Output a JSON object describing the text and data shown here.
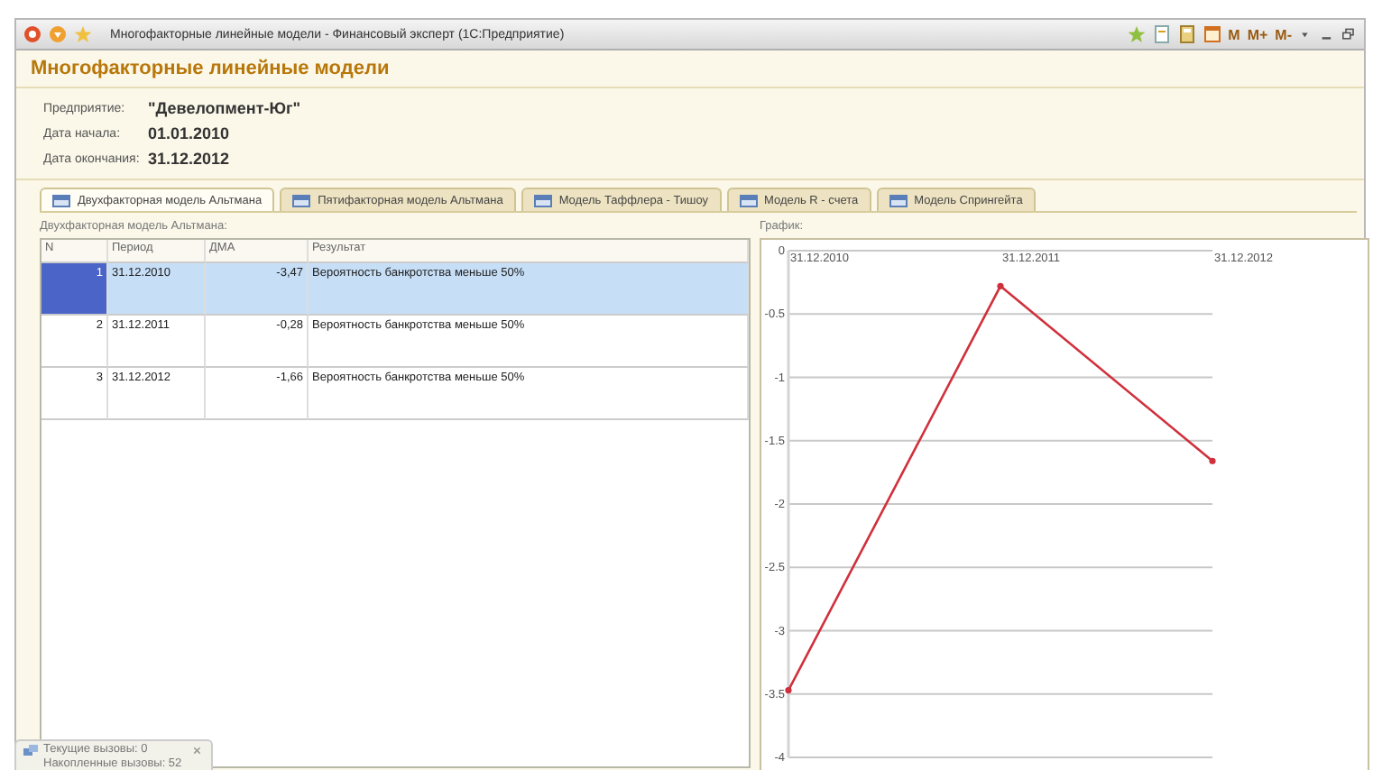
{
  "window": {
    "title": "Многофакторные линейные модели - Финансовый эксперт  (1С:Предприятие)",
    "toolbar_buttons": [
      "M",
      "M+",
      "M-"
    ]
  },
  "form": {
    "title": "Многофакторные линейные модели",
    "fields": [
      {
        "label": "Предприятие:",
        "value": "\"Девелопмент-Юг\""
      },
      {
        "label": "Дата начала:",
        "value": "01.01.2010"
      },
      {
        "label": "Дата окончания:",
        "value": "31.12.2012"
      }
    ]
  },
  "tabs": [
    {
      "label": "Двухфакторная модель Альтмана",
      "selected": true
    },
    {
      "label": "Пятифакторная модель Альтмана",
      "selected": false
    },
    {
      "label": "Модель Таффлера - Тишоу",
      "selected": false
    },
    {
      "label": "Модель R - счета",
      "selected": false
    },
    {
      "label": "Модель Спрингейта",
      "selected": false
    }
  ],
  "table": {
    "caption": "Двухфакторная модель Альтмана:",
    "columns": [
      "N",
      "Период",
      "ДМА",
      "Результат"
    ],
    "rows": [
      {
        "cells": [
          "1",
          "31.12.2010",
          "-3,47",
          "Вероятность банкротства меньше 50%"
        ],
        "selected": true
      },
      {
        "cells": [
          "2",
          "31.12.2011",
          "-0,28",
          "Вероятность банкротства меньше 50%"
        ],
        "selected": false
      },
      {
        "cells": [
          "3",
          "31.12.2012",
          "-1,66",
          "Вероятность банкротства меньше 50%"
        ],
        "selected": false
      }
    ]
  },
  "chart": {
    "caption": "График:",
    "chart_data": {
      "type": "line",
      "categories": [
        "31.12.2010",
        "31.12.2011",
        "31.12.2012"
      ],
      "series": [
        {
          "color": "#d0303c",
          "marker": "circle",
          "values": [
            -3.47,
            -0.28,
            -1.66
          ]
        }
      ],
      "grid": true,
      "ylim": [
        -4,
        0
      ],
      "yticks": [
        0,
        -0.5,
        -1,
        -1.5,
        -2,
        -2.5,
        -3,
        -3.5,
        -4
      ]
    }
  },
  "notification": {
    "lines": [
      "Текущие вызовы: 0",
      "Накопленные вызовы: 52"
    ]
  }
}
